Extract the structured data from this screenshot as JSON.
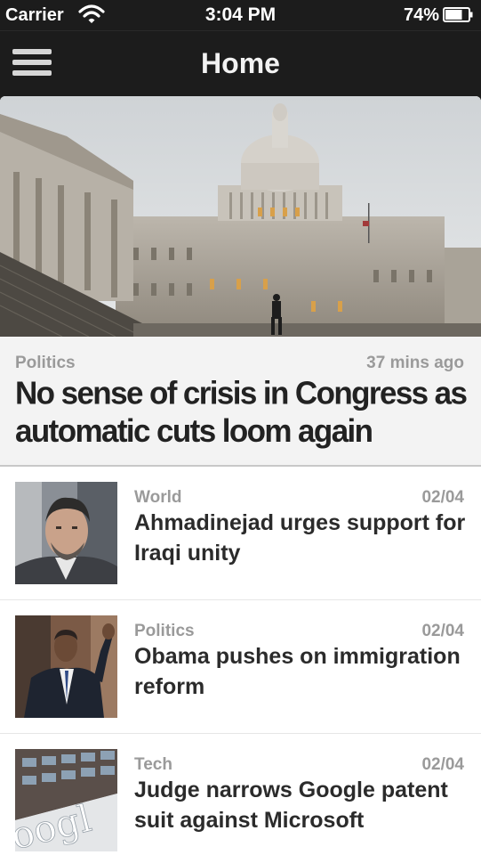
{
  "status_bar": {
    "carrier": "Carrier",
    "time": "3:04 PM",
    "battery_percent": "74%",
    "battery_level": 0.74,
    "icons": [
      "wifi-icon",
      "battery-icon"
    ]
  },
  "nav": {
    "title": "Home",
    "menu_icon": "hamburger-menu-icon"
  },
  "hero": {
    "category": "Politics",
    "time": "37 mins ago",
    "headline": "No sense of crisis in Congress as automatic cuts loom again",
    "image": "capitol-building-photo"
  },
  "articles": [
    {
      "category": "World",
      "date": "02/04",
      "headline": "Ahmadinejad urges support for Iraqi unity",
      "image": "ahmadinejad-portrait-photo"
    },
    {
      "category": "Politics",
      "date": "02/04",
      "headline": "Obama pushes on immigration reform",
      "image": "obama-waving-photo"
    },
    {
      "category": "Tech",
      "date": "02/04",
      "headline": "Judge narrows Google patent suit against Microsoft",
      "image": "google-building-sign-photo",
      "image_text": "oogl"
    }
  ],
  "colors": {
    "chrome": "#1c1c1c",
    "meta_gray": "#9a9a9a",
    "headline": "#222222",
    "hero_bg": "#f3f3f3"
  }
}
